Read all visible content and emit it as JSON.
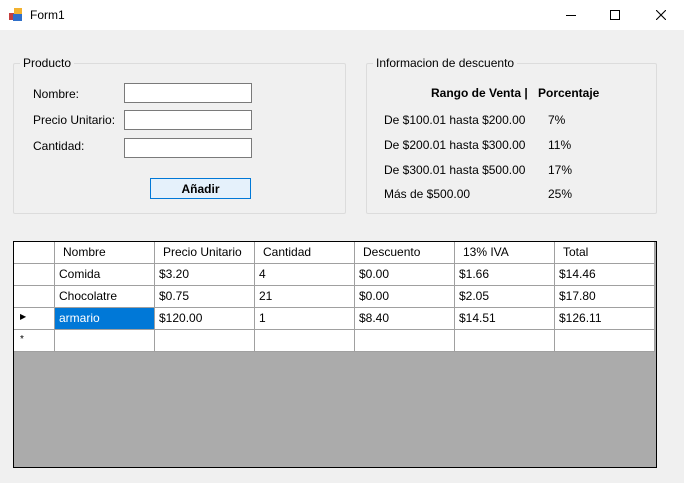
{
  "window": {
    "title": "Form1",
    "controls": {
      "minimize_icon": "minimize-icon",
      "maximize_icon": "maximize-icon",
      "close_icon": "close-icon"
    }
  },
  "producto": {
    "legend": "Producto",
    "nombre_label": "Nombre:",
    "precio_label": "Precio Unitario:",
    "cantidad_label": "Cantidad:",
    "nombre_value": "",
    "precio_value": "",
    "cantidad_value": "",
    "add_button": "Añadir"
  },
  "descuento": {
    "legend": "Informacion de descuento",
    "header_range": "Rango de Venta |",
    "header_pct": "Porcentaje",
    "rows": [
      {
        "range": "De $100.01 hasta $200.00",
        "pct": "7%"
      },
      {
        "range": "De $200.01 hasta $300.00",
        "pct": "11%"
      },
      {
        "range": "De $300.01 hasta $500.00",
        "pct": "17%"
      },
      {
        "range": "Más de $500.00",
        "pct": "25%"
      }
    ]
  },
  "grid": {
    "columns": [
      "Nombre",
      "Precio Unitario",
      "Cantidad",
      "Descuento",
      "13% IVA",
      "Total"
    ],
    "rows": [
      [
        "Comida",
        "$3.20",
        "4",
        "$0.00",
        "$1.66",
        "$14.46"
      ],
      [
        "Chocolatre",
        "$0.75",
        "21",
        "$0.00",
        "$2.05",
        "$17.80"
      ],
      [
        "armario",
        "$120.00",
        "1",
        "$8.40",
        "$14.51",
        "$126.11"
      ]
    ],
    "current_row_marker": "▶",
    "new_row_marker": "*",
    "colors": {
      "selection": "#0078d7",
      "empty_area": "#ababab"
    }
  }
}
